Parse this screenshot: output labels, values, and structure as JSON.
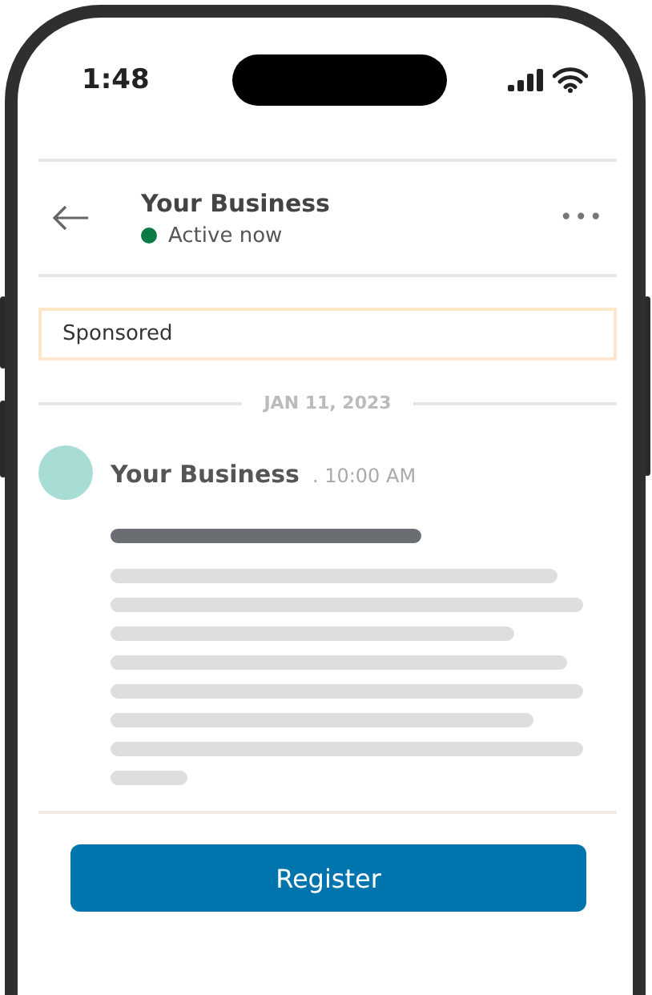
{
  "status_bar": {
    "time": "1:48"
  },
  "header": {
    "title": "Your Business",
    "status": "Active now",
    "active": true,
    "menu": "•••"
  },
  "sponsored": "Sponsored",
  "date_separator": "JAN 11, 2023",
  "message": {
    "sender": "Your Business",
    "time": ". 10:00 AM"
  },
  "button": "Register"
}
